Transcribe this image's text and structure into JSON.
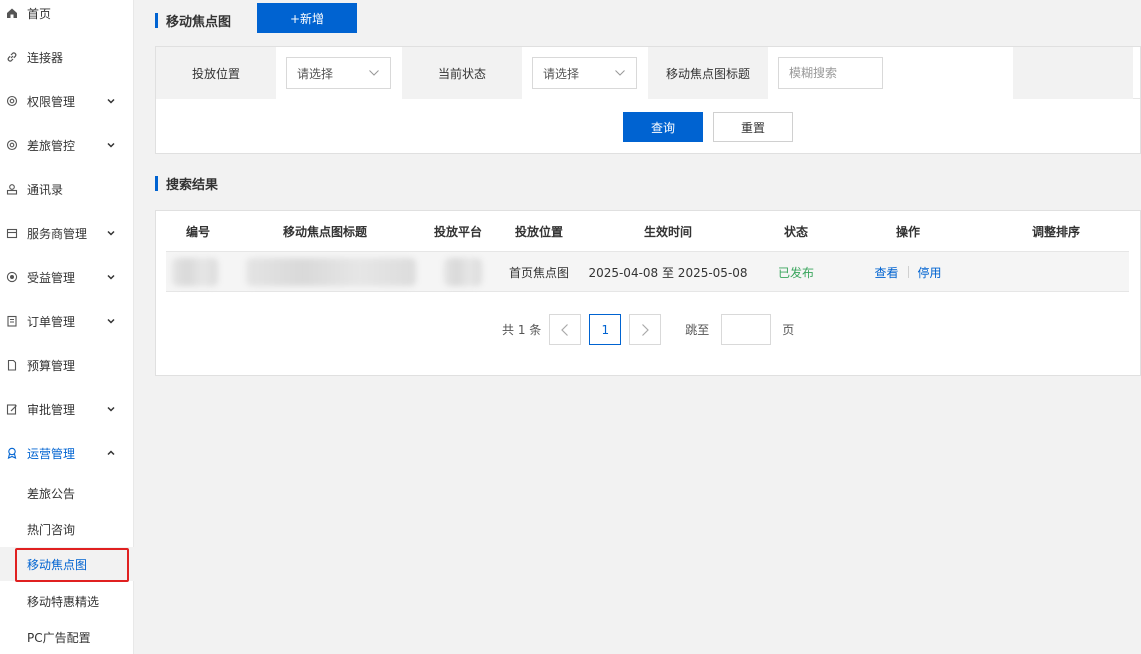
{
  "sidebar": {
    "items": [
      {
        "label": "首页"
      },
      {
        "label": "连接器"
      },
      {
        "label": "权限管理"
      },
      {
        "label": "差旅管控"
      },
      {
        "label": "通讯录"
      },
      {
        "label": "服务商管理"
      },
      {
        "label": "受益管理"
      },
      {
        "label": "订单管理"
      },
      {
        "label": "预算管理"
      },
      {
        "label": "审批管理"
      },
      {
        "label": "运营管理"
      }
    ],
    "sub_items": [
      {
        "label": "差旅公告"
      },
      {
        "label": "热门咨询"
      },
      {
        "label": "移动焦点图"
      },
      {
        "label": "移动特惠精选"
      },
      {
        "label": "PC广告配置"
      }
    ]
  },
  "header": {
    "title": "移动焦点图",
    "add_label": "+新增"
  },
  "filters": {
    "position_label": "投放位置",
    "position_placeholder": "请选择",
    "status_label": "当前状态",
    "status_placeholder": "请选择",
    "title_label": "移动焦点图标题",
    "title_placeholder": "模糊搜索",
    "query_label": "查询",
    "reset_label": "重置"
  },
  "results": {
    "title": "搜索结果",
    "columns": [
      "编号",
      "移动焦点图标题",
      "投放平台",
      "投放位置",
      "生效时间",
      "状态",
      "操作",
      "调整排序"
    ],
    "rows": [
      {
        "position": "首页焦点图",
        "effective_time": "2025-04-08 至 2025-05-08",
        "status": "已发布",
        "op_view": "查看",
        "op_disable": "停用"
      }
    ]
  },
  "pagination": {
    "total_text": "共 1 条",
    "current_page": "1",
    "jump_label": "跳至",
    "page_unit": "页"
  },
  "colors": {
    "primary": "#0063d1",
    "published": "#3aa55d",
    "highlight": "#e02020"
  }
}
